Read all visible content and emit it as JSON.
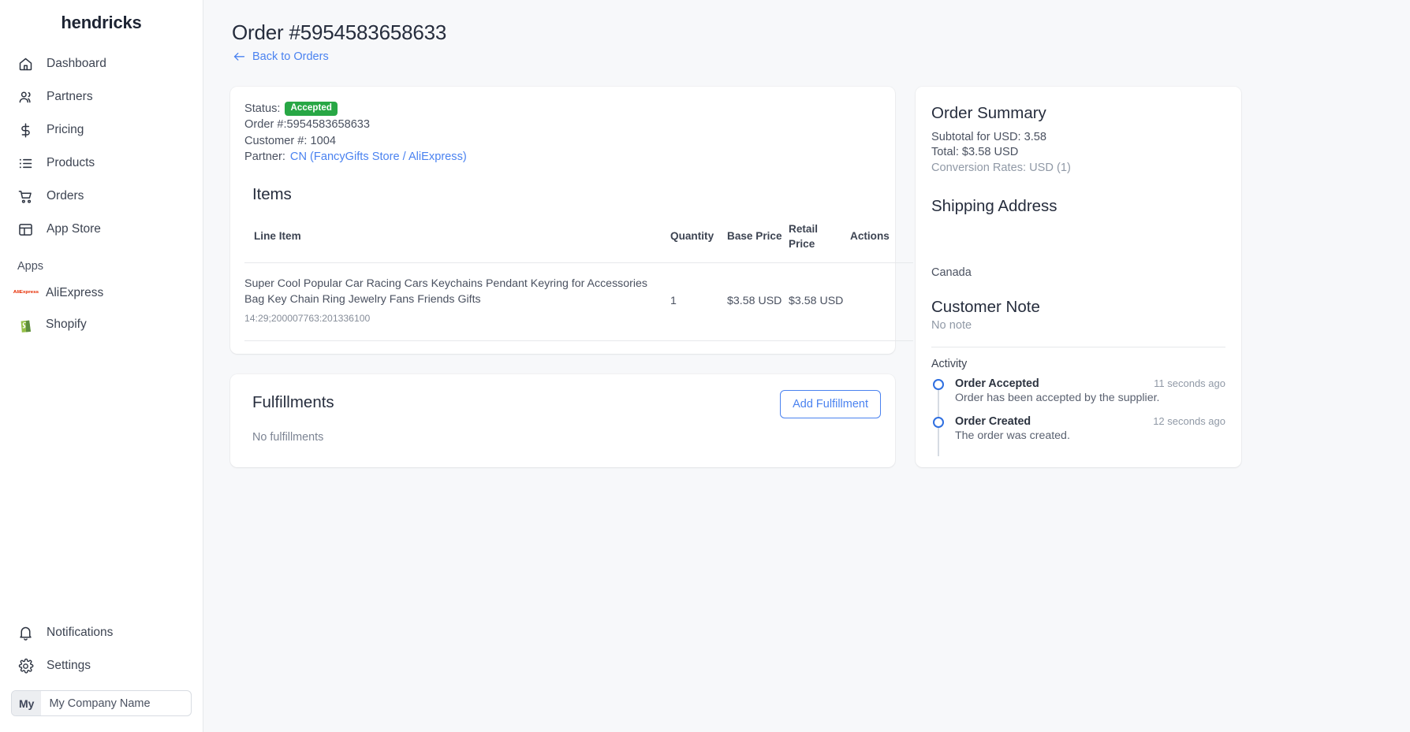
{
  "sidebar": {
    "brand": "hendricks",
    "nav": [
      {
        "label": "Dashboard",
        "icon": "home-icon"
      },
      {
        "label": "Partners",
        "icon": "users-icon"
      },
      {
        "label": "Pricing",
        "icon": "dollar-icon"
      },
      {
        "label": "Products",
        "icon": "list-icon"
      },
      {
        "label": "Orders",
        "icon": "cart-icon"
      },
      {
        "label": "App Store",
        "icon": "layout-icon"
      }
    ],
    "apps_label": "Apps",
    "apps": [
      {
        "label": "AliExpress",
        "icon": "aliexpress-icon"
      },
      {
        "label": "Shopify",
        "icon": "shopify-icon"
      }
    ],
    "bottom": [
      {
        "label": "Notifications",
        "icon": "bell-icon"
      },
      {
        "label": "Settings",
        "icon": "gear-icon"
      }
    ],
    "company": {
      "initials": "My",
      "name": "My Company Name"
    }
  },
  "header": {
    "title": "Order #5954583658633",
    "back_label": "Back to Orders"
  },
  "order": {
    "status_label": "Status:",
    "status_value": "Accepted",
    "status_color": "#28a745",
    "order_number": "Order #:5954583658633",
    "customer_number": "Customer #: 1004",
    "partner_label": "Partner:",
    "partner_value": "CN (FancyGifts Store / AliExpress)",
    "items_heading": "Items",
    "columns": [
      "Line Item",
      "Quantity",
      "Base Price",
      "Retail Price",
      "Actions"
    ],
    "rows": [
      {
        "line_item": "Super Cool Popular Car Racing Cars Keychains Pendant Keyring for Accessories Bag Key Chain Ring Jewelry Fans Friends Gifts",
        "sku": "14:29;200007763:201336100",
        "quantity": "1",
        "base_price": "$3.58 USD",
        "retail_price": "$3.58 USD",
        "actions": ""
      }
    ]
  },
  "fulfillments": {
    "title": "Fulfillments",
    "empty_text": "No fulfillments",
    "add_button": "Add Fulfillment"
  },
  "summary": {
    "title": "Order Summary",
    "subtotal": "Subtotal for USD: 3.58",
    "total": "Total: $3.58 USD",
    "conversion": "Conversion Rates: USD (1)",
    "shipping_title": "Shipping Address",
    "shipping_lines": [
      "",
      "",
      "",
      "Canada"
    ],
    "note_title": "Customer Note",
    "note_text": "No note",
    "activity_label": "Activity",
    "activity": [
      {
        "title": "Order Accepted",
        "time": "11 seconds ago",
        "description": "Order has been accepted by the supplier."
      },
      {
        "title": "Order Created",
        "time": "12 seconds ago",
        "description": "The order was created."
      }
    ]
  }
}
